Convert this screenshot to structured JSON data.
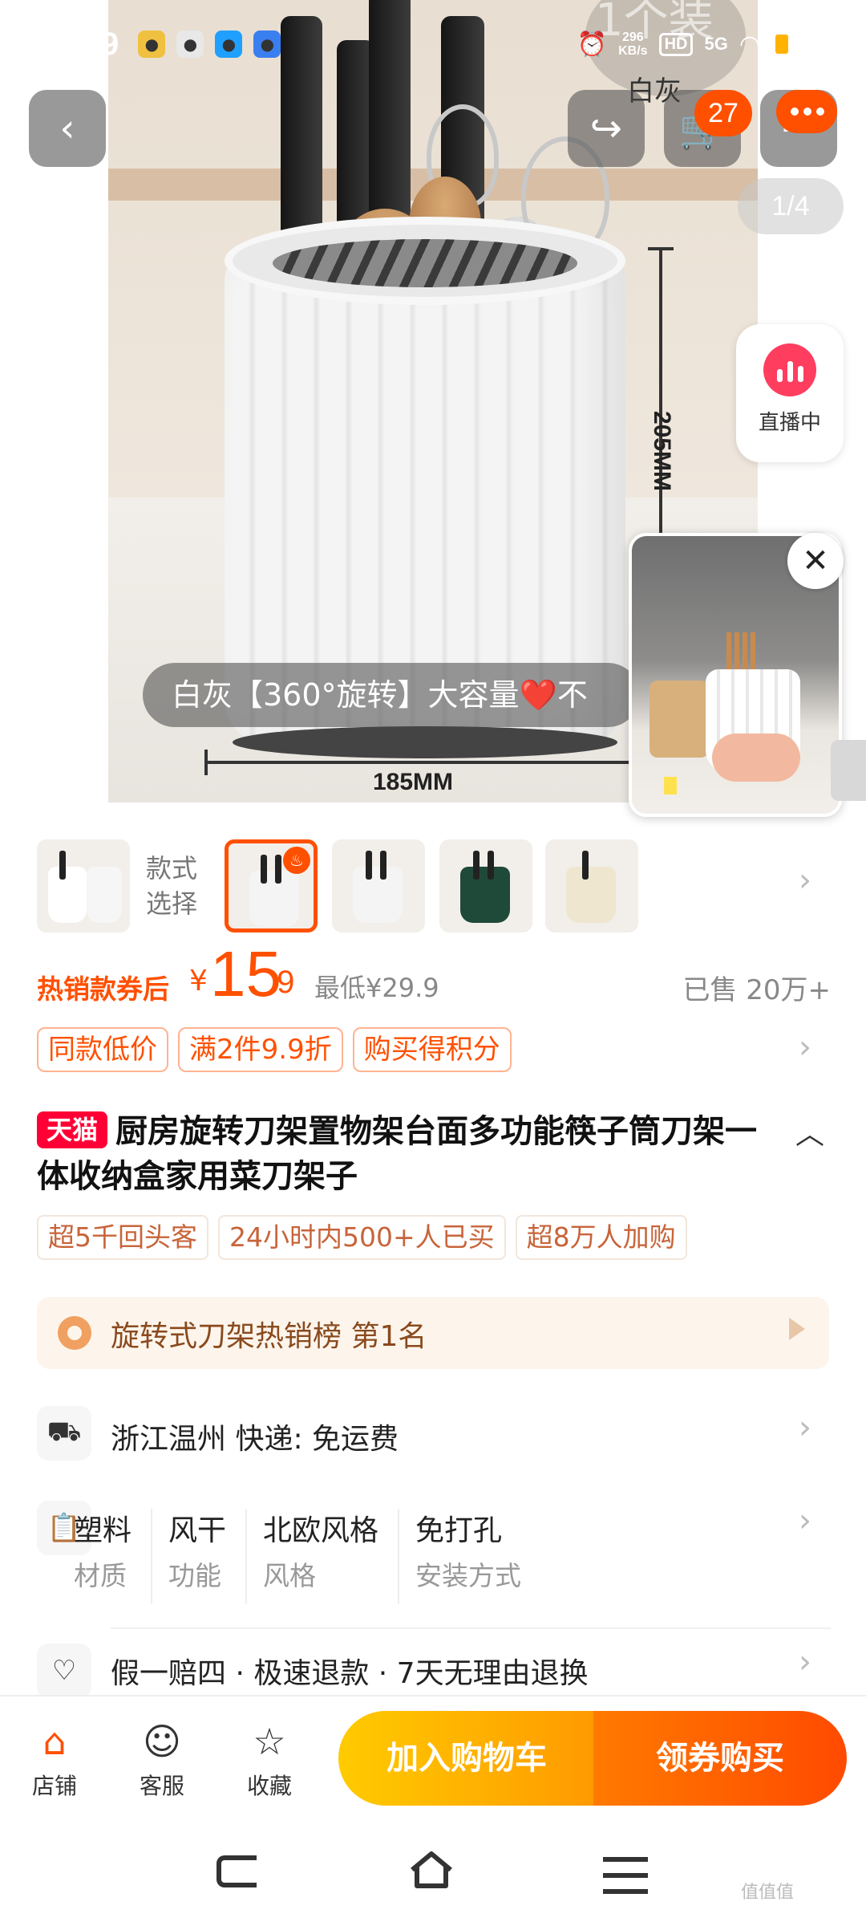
{
  "status_bar": {
    "time": "23:49",
    "net_speed": "296",
    "net_unit": "KB/s",
    "hd": "HD",
    "signal": "5G",
    "battery": "15"
  },
  "hero": {
    "watermark_top": "1个装",
    "watermark_color": "白灰",
    "dimension_height": "205MM",
    "dimension_width": "185MM",
    "caption": "白灰【360°旋转】大容量❤️不",
    "cart_count": "27",
    "image_counter": "1/4",
    "live_label": "直播中",
    "close_symbol": "✕"
  },
  "styles": {
    "label": "款式选择"
  },
  "price": {
    "prefix": "热销款券后",
    "currency": "¥",
    "integer": "15",
    "decimal": ".9",
    "lowest": "最低¥29.9",
    "sold": "已售 20万+"
  },
  "promos": [
    "同款低价",
    "满2件9.9折",
    "购买得积分"
  ],
  "title": {
    "badge": "天猫",
    "text": "厨房旋转刀架置物架台面多功能筷子筒刀架一体收纳盒家用菜刀架子",
    "collapse_symbol": "︿"
  },
  "tags": [
    "超5千回头客",
    "24小时内500+人已买",
    "超8万人加购"
  ],
  "rank": {
    "text": "旋转式刀架热销榜 第1名"
  },
  "shipping": {
    "text": "浙江温州  快递: 免运费"
  },
  "attributes": [
    {
      "value": "塑料",
      "key": "材质"
    },
    {
      "value": "风干",
      "key": "功能"
    },
    {
      "value": "北欧风格",
      "key": "风格"
    },
    {
      "value": "免打孔",
      "key": "安装方式"
    }
  ],
  "guarantee": {
    "text": "假一赔四 · 极速退款 · 7天无理由退换"
  },
  "bottom_bar": {
    "store": "店铺",
    "service": "客服",
    "favorite": "收藏",
    "add_to_cart": "加入购物车",
    "buy": "领券购买"
  },
  "corner_watermark": "值值值",
  "colors": {
    "accent": "#ff5000",
    "tmall": "#ff0036",
    "cart_button": "#ffb300",
    "buy_button": "#ff5a00"
  }
}
